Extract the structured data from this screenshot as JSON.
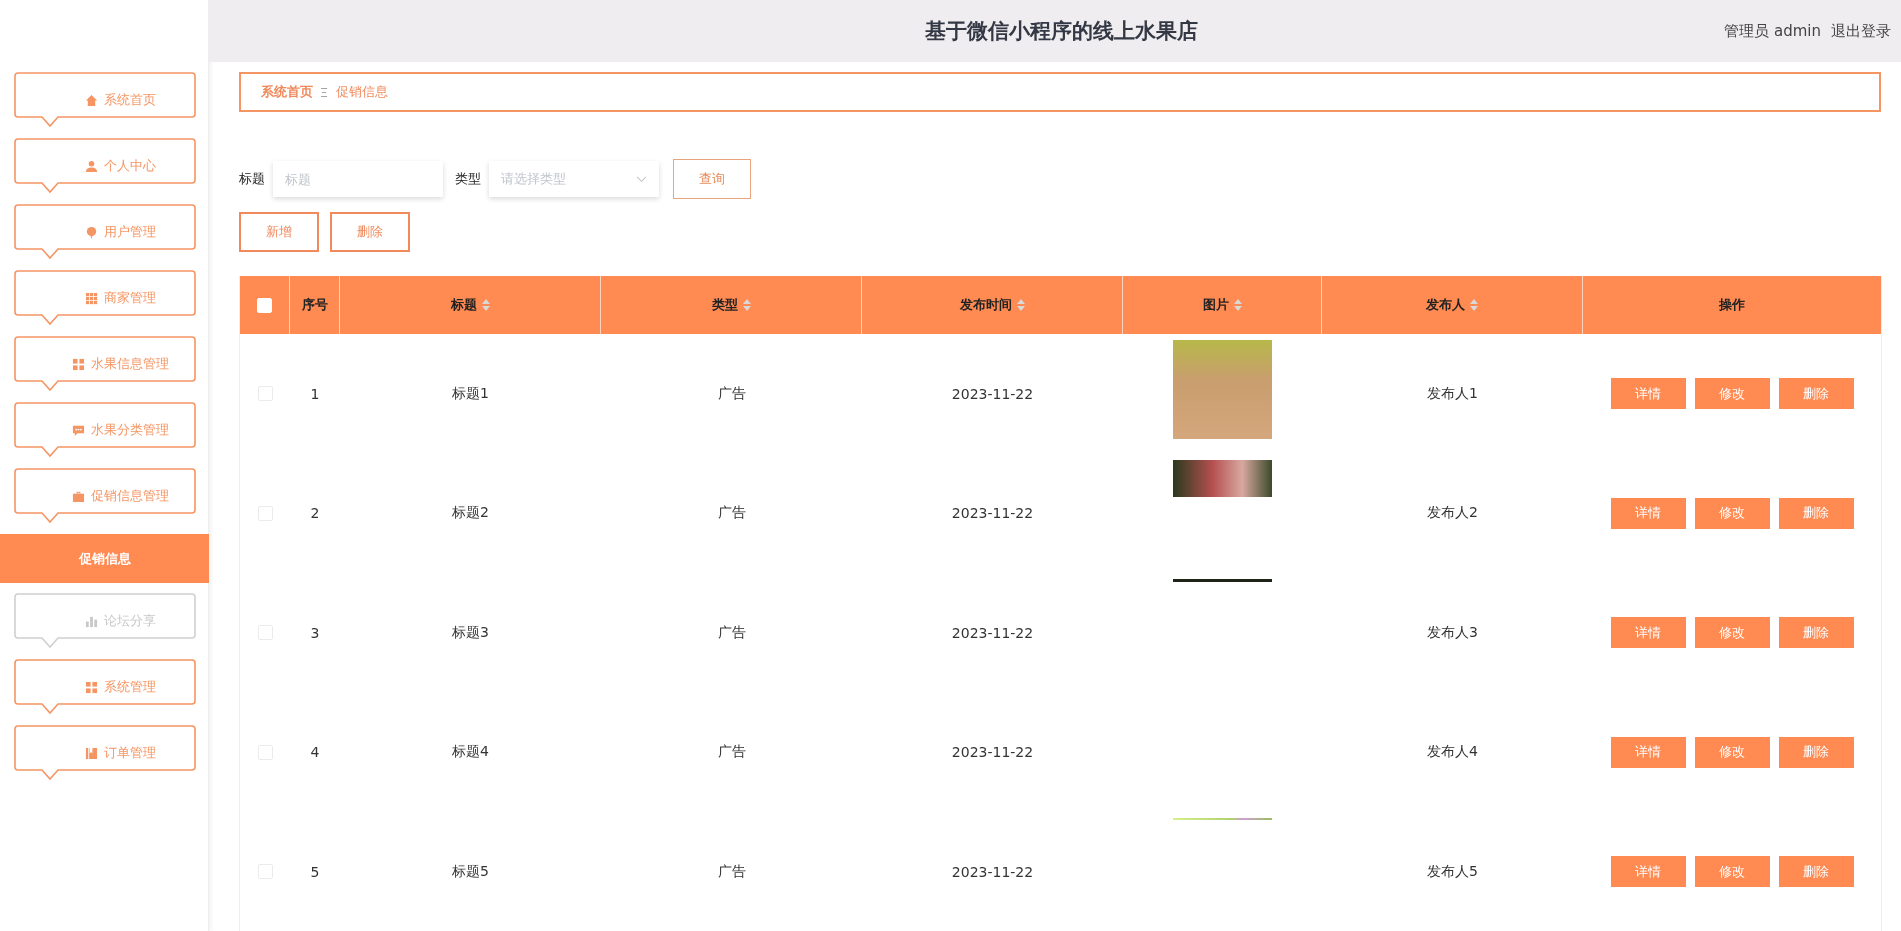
{
  "header": {
    "title": "基于微信小程序的线上水果店",
    "user": "管理员 admin",
    "logout": "退出登录"
  },
  "sidebar": {
    "items": [
      {
        "label": "系统首页",
        "kind": "menu",
        "selected": false,
        "hovered": false
      },
      {
        "label": "个人中心",
        "kind": "menu",
        "selected": false,
        "hovered": false
      },
      {
        "label": "用户管理",
        "kind": "menu",
        "selected": false,
        "hovered": false
      },
      {
        "label": "商家管理",
        "kind": "menu",
        "selected": false,
        "hovered": false
      },
      {
        "label": "水果信息管理",
        "kind": "menu",
        "selected": false,
        "hovered": false
      },
      {
        "label": "水果分类管理",
        "kind": "menu",
        "selected": false,
        "hovered": false
      },
      {
        "label": "促销信息管理",
        "kind": "menu",
        "selected": false,
        "hovered": false
      },
      {
        "label": "促销信息",
        "kind": "sub",
        "selected": true,
        "hovered": false
      },
      {
        "label": "论坛分享",
        "kind": "menu",
        "selected": false,
        "hovered": true
      },
      {
        "label": "系统管理",
        "kind": "menu",
        "selected": false,
        "hovered": false
      },
      {
        "label": "订单管理",
        "kind": "menu",
        "selected": false,
        "hovered": false
      }
    ]
  },
  "breadcrumb": [
    "系统首页",
    "促销信息"
  ],
  "search": {
    "fields": [
      {
        "label": "标题",
        "placeholder": "标题",
        "kind": "input"
      },
      {
        "label": "类型",
        "placeholder": "请选择类型",
        "kind": "select"
      }
    ],
    "button": "查询"
  },
  "actions": [
    "新增",
    "删除"
  ],
  "table": {
    "all_checked": false,
    "columns": [
      {
        "label": "序号",
        "sortable": false
      },
      {
        "label": "标题",
        "sortable": true
      },
      {
        "label": "类型",
        "sortable": true
      },
      {
        "label": "发布时间",
        "sortable": true
      },
      {
        "label": "图片",
        "sortable": true
      },
      {
        "label": "发布人",
        "sortable": true
      },
      {
        "label": "操作",
        "sortable": false
      }
    ],
    "rows": [
      {
        "checked": false,
        "index": "1",
        "title": "标题1",
        "type": "广告",
        "date": "2023-11-22",
        "kind": "full",
        "publisher": "发布人1",
        "actions": [
          "详情",
          "修改",
          "删除"
        ]
      },
      {
        "checked": false,
        "index": "2",
        "title": "标题2",
        "type": "广告",
        "date": "2023-11-22",
        "kind": "partial",
        "publisher": "发布人2",
        "actions": [
          "详情",
          "修改",
          "删除"
        ]
      },
      {
        "checked": false,
        "index": "3",
        "title": "标题3",
        "type": "广告",
        "date": "2023-11-22",
        "kind": "line",
        "publisher": "发布人3",
        "actions": [
          "详情",
          "修改",
          "删除"
        ]
      },
      {
        "checked": false,
        "index": "4",
        "title": "标题4",
        "type": "广告",
        "date": "2023-11-22",
        "kind": "none",
        "publisher": "发布人4",
        "actions": [
          "详情",
          "修改",
          "删除"
        ]
      },
      {
        "checked": false,
        "index": "5",
        "title": "标题5",
        "type": "广告",
        "date": "2023-11-22",
        "kind": "strip",
        "publisher": "发布人5",
        "actions": [
          "详情",
          "修改",
          "删除"
        ]
      }
    ]
  }
}
